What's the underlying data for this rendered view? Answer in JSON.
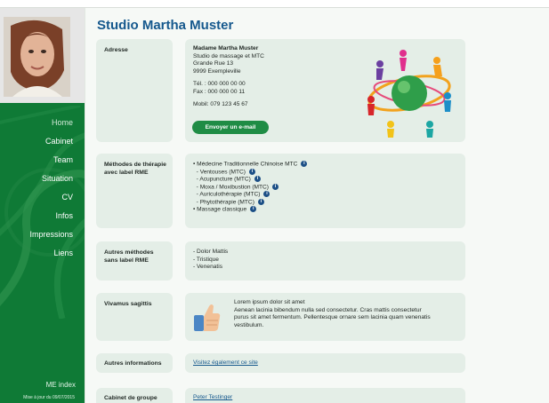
{
  "site": {
    "title": "Studio Martha Muster"
  },
  "sidebar": {
    "nav": [
      {
        "label": "Home"
      },
      {
        "label": "Cabinet"
      },
      {
        "label": "Team"
      },
      {
        "label": "Situation"
      },
      {
        "label": "CV"
      },
      {
        "label": "Infos"
      },
      {
        "label": "Impressions"
      },
      {
        "label": "Liens"
      }
    ],
    "logo_text": "ME index",
    "updated_text": "Mise à jour du 09/07/2015"
  },
  "sections": {
    "adresse": {
      "label": "Adresse",
      "name": "Madame Martha Muster",
      "business": "Studio de massage et MTC",
      "street": "Grande Rue 13",
      "city": "9999 Exempleville",
      "tel": "Tél. : 000 000 00 00",
      "fax": "Fax : 000 000 00 11",
      "mobil": "Mobil: 079 123 45 67",
      "email_button": "Envoyer un e-mail"
    },
    "methodes": {
      "label": "Méthodes de thérapie avec label RME",
      "items": [
        "• Médecine Traditionnelle Chinoise MTC",
        "  - Ventouses (MTC)",
        "  - Acupuncture (MTC)",
        "  - Moxa / Moxibustion (MTC)",
        "  - Auriculothérapie (MTC)",
        "  - Phytothérapie (MTC)",
        "• Massage classique"
      ]
    },
    "autres_methodes": {
      "label": "Autres méthodes sans label RME",
      "items": [
        "- Dolor Mattis",
        "- Tristique",
        "- Venenatis"
      ]
    },
    "vivamus": {
      "label": "Vivamus sagittis",
      "lines": [
        "Lorem ipsum dolor sit amet",
        "Aenean lacinia bibendum nulla sed consectetur. Cras mattis consectetur",
        "purus sit amet fermentum. Pellentesque ornare sem lacinia quam venenatis",
        "vestibulum."
      ]
    },
    "autres_infos": {
      "label": "Autres informations",
      "link": "Visitez également ce site"
    },
    "cabinet": {
      "label": "Cabinet de groupe",
      "link": "Peter Testinger"
    }
  },
  "colors": {
    "sidebar_green": "#0f7a36",
    "title_blue": "#15588d",
    "box_bg": "#e4eee7",
    "button_green": "#1f8c45"
  },
  "icons": [
    "info-icon",
    "thumbs-up-icon",
    "people-circle-icon",
    "portrait-photo"
  ]
}
